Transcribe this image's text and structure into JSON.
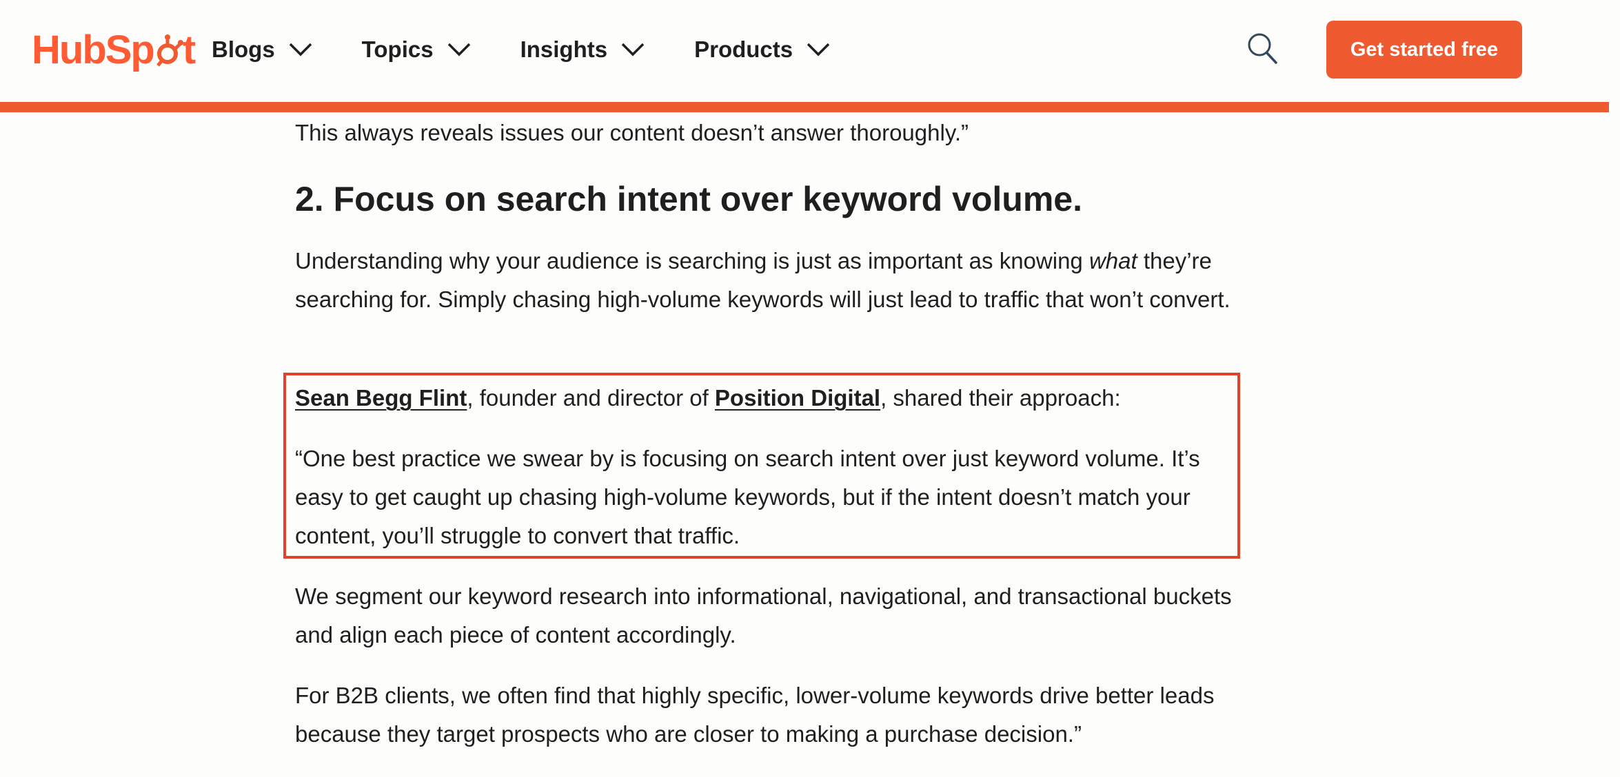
{
  "header": {
    "logo_text_a": "HubSp",
    "logo_text_b": "t",
    "nav": [
      {
        "label": "Blogs"
      },
      {
        "label": "Topics"
      },
      {
        "label": "Insights"
      },
      {
        "label": "Products"
      }
    ],
    "cta_label": "Get started free"
  },
  "colors": {
    "brand_orange": "#f05a31",
    "highlight_border": "#e0432b",
    "text": "#1f1f1f"
  },
  "article": {
    "intro_tail": "This always reveals issues our content doesn’t answer thoroughly.”",
    "heading": "2. Focus on search intent over keyword volume.",
    "para1_before": "Understanding why your audience is searching is just as important as knowing ",
    "para1_em": "what",
    "para1_after": " they’re searching for. Simply chasing high-volume keywords will just lead to traffic that won’t convert.",
    "quote_author_link": "Sean Begg Flint",
    "quote_mid": ", founder and director of ",
    "quote_company_link": "Position Digital",
    "quote_end": ", shared their approach:",
    "quote_para1": "“One best practice we swear by is focusing on search intent over just keyword volume. It’s easy to get caught up chasing high-volume keywords, but if the intent doesn’t match your content, you’ll struggle to convert that traffic.",
    "quote_para2": "We segment our keyword research into informational, navigational, and transactional buckets and align each piece of content accordingly.",
    "quote_para3": "For B2B clients, we often find that highly specific, lower-volume keywords drive better leads because they target prospects who are closer to making a purchase decision.”"
  }
}
